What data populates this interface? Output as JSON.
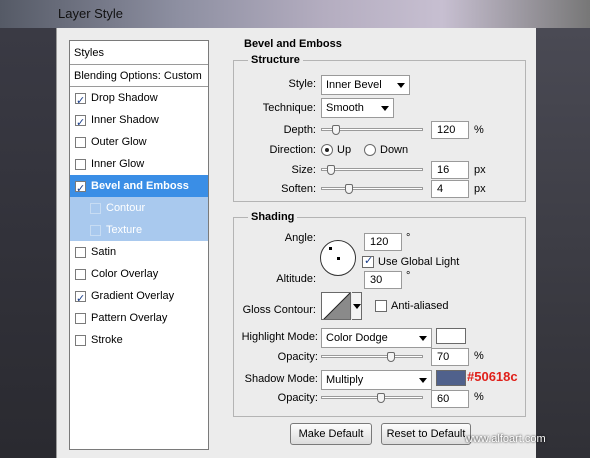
{
  "window": {
    "title": "Layer Style"
  },
  "styles_panel": {
    "header": "Styles",
    "blending": "Blending Options: Custom",
    "items": [
      {
        "label": "Drop Shadow",
        "checked": true,
        "sub": false,
        "selected": false
      },
      {
        "label": "Inner Shadow",
        "checked": true,
        "sub": false,
        "selected": false
      },
      {
        "label": "Outer Glow",
        "checked": false,
        "sub": false,
        "selected": false
      },
      {
        "label": "Inner Glow",
        "checked": false,
        "sub": false,
        "selected": false
      },
      {
        "label": "Bevel and Emboss",
        "checked": true,
        "sub": false,
        "selected": true
      },
      {
        "label": "Contour",
        "checked": false,
        "sub": true,
        "selected": false
      },
      {
        "label": "Texture",
        "checked": false,
        "sub": true,
        "selected": false
      },
      {
        "label": "Satin",
        "checked": false,
        "sub": false,
        "selected": false
      },
      {
        "label": "Color Overlay",
        "checked": false,
        "sub": false,
        "selected": false
      },
      {
        "label": "Gradient Overlay",
        "checked": true,
        "sub": false,
        "selected": false
      },
      {
        "label": "Pattern Overlay",
        "checked": false,
        "sub": false,
        "selected": false
      },
      {
        "label": "Stroke",
        "checked": false,
        "sub": false,
        "selected": false
      }
    ]
  },
  "bevel": {
    "section_title": "Bevel and Emboss",
    "structure": {
      "title": "Structure",
      "style_label": "Style:",
      "style_value": "Inner Bevel",
      "technique_label": "Technique:",
      "technique_value": "Smooth",
      "depth_label": "Depth:",
      "depth_value": "120",
      "depth_unit": "%",
      "depth_level": 0.12,
      "direction_label": "Direction:",
      "direction_up": "Up",
      "direction_down": "Down",
      "size_label": "Size:",
      "size_value": "16",
      "size_unit": "px",
      "size_level": 0.065,
      "soften_label": "Soften:",
      "soften_value": "4",
      "soften_unit": "px",
      "soften_level": 0.25
    },
    "shading": {
      "title": "Shading",
      "angle_label": "Angle:",
      "angle_value": "120",
      "angle_unit": "°",
      "global_light_label": "Use Global Light",
      "altitude_label": "Altitude:",
      "altitude_value": "30",
      "altitude_unit": "°",
      "gloss_label": "Gloss Contour:",
      "antialiased_label": "Anti-aliased",
      "highlight_mode_label": "Highlight Mode:",
      "highlight_mode_value": "Color Dodge",
      "highlight_color": "#ffffff",
      "highlight_opacity_label": "Opacity:",
      "highlight_opacity_value": "70",
      "highlight_opacity_unit": "%",
      "highlight_opacity_level": 0.7,
      "shadow_mode_label": "Shadow Mode:",
      "shadow_mode_value": "Multiply",
      "shadow_color": "#50618c",
      "shadow_color_label": "#50618c",
      "shadow_opacity_label": "Opacity:",
      "shadow_opacity_value": "60",
      "shadow_opacity_unit": "%",
      "shadow_opacity_level": 0.6
    },
    "buttons": {
      "make_default": "Make Default",
      "reset_default": "Reset to Default"
    }
  },
  "watermark": "www.alfoart.com"
}
